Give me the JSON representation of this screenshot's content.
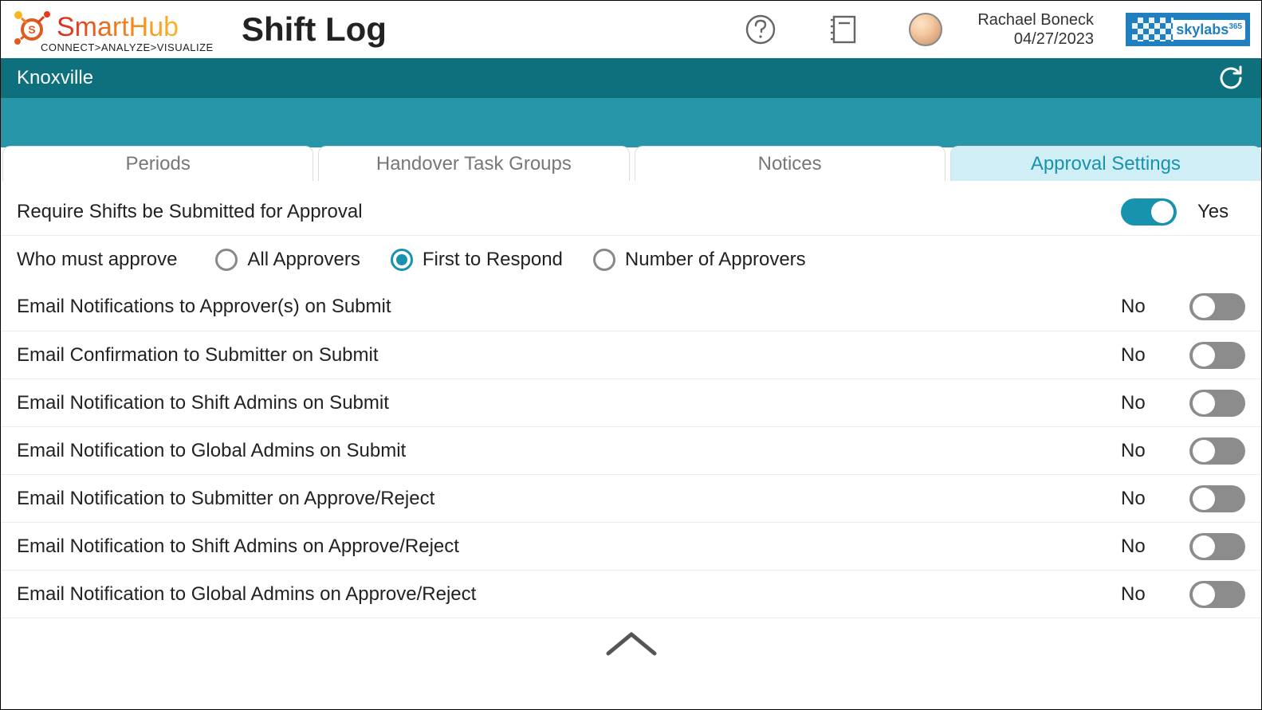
{
  "header": {
    "brand_name": "SmartHub",
    "brand_tagline": "CONNECT>ANALYZE>VISUALIZE",
    "page_title": "Shift Log",
    "user_name": "Rachael Boneck",
    "date": "04/27/2023",
    "partner_brand": "skylabs",
    "partner_brand_sup": "365"
  },
  "location_bar": {
    "location": "Knoxville"
  },
  "tabs": [
    {
      "label": "Periods",
      "active": false
    },
    {
      "label": "Handover Task Groups",
      "active": false
    },
    {
      "label": "Notices",
      "active": false
    },
    {
      "label": "Approval Settings",
      "active": true
    }
  ],
  "settings": {
    "require_approval": {
      "label": "Require Shifts be Submitted for Approval",
      "value": true,
      "value_text": "Yes"
    },
    "who_must_approve": {
      "label": "Who must approve",
      "options": [
        "All Approvers",
        "First to Respond",
        "Number of Approvers"
      ],
      "selected_index": 1
    },
    "email_rows": [
      {
        "label": "Email Notifications to Approver(s) on Submit",
        "value": false,
        "value_text": "No"
      },
      {
        "label": "Email Confirmation to Submitter on Submit",
        "value": false,
        "value_text": "No"
      },
      {
        "label": "Email Notification to Shift Admins on Submit",
        "value": false,
        "value_text": "No"
      },
      {
        "label": "Email Notification to Global Admins on Submit",
        "value": false,
        "value_text": "No"
      },
      {
        "label": "Email Notification to Submitter on Approve/Reject",
        "value": false,
        "value_text": "No"
      },
      {
        "label": "Email Notification to Shift Admins on Approve/Reject",
        "value": false,
        "value_text": "No"
      },
      {
        "label": "Email Notification to Global Admins on Approve/Reject",
        "value": false,
        "value_text": "No"
      }
    ]
  }
}
